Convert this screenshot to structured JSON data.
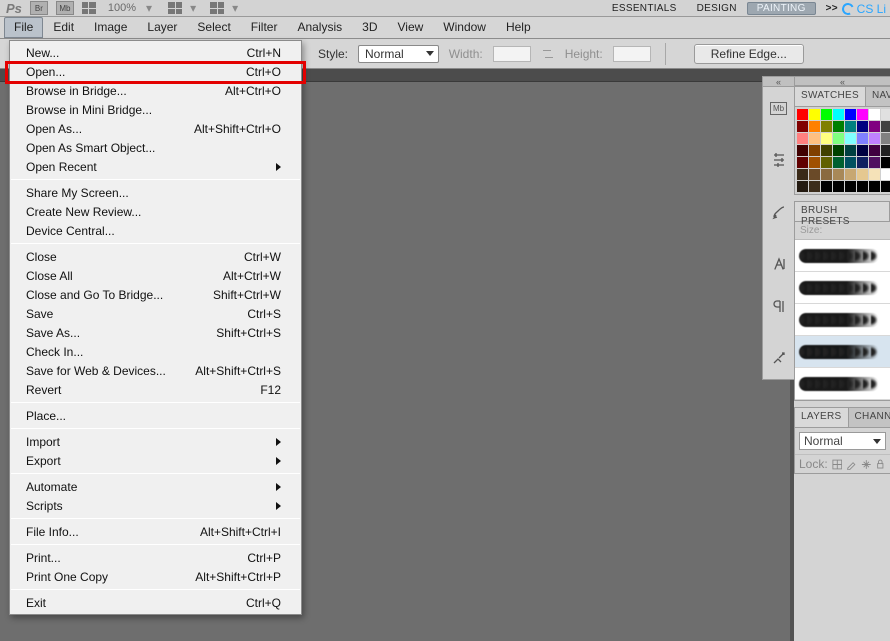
{
  "topstrip": {
    "icons": [
      "Br",
      "Mb"
    ],
    "zoom": "100%",
    "workspaces": [
      "ESSENTIALS",
      "DESIGN",
      "PAINTING"
    ],
    "active_workspace": 2,
    "more": ">>",
    "cs_label": "CS Li"
  },
  "menubar": [
    "File",
    "Edit",
    "Image",
    "Layer",
    "Select",
    "Filter",
    "Analysis",
    "3D",
    "View",
    "Window",
    "Help"
  ],
  "menubar_active": 0,
  "optionsbar": {
    "style_label": "Style:",
    "style_value": "Normal",
    "width_label": "Width:",
    "height_label": "Height:",
    "refine_label": "Refine Edge..."
  },
  "file_menu": [
    {
      "label": "New...",
      "shortcut": "Ctrl+N"
    },
    {
      "label": "Open...",
      "shortcut": "Ctrl+O",
      "highlight": true
    },
    {
      "label": "Browse in Bridge...",
      "shortcut": "Alt+Ctrl+O"
    },
    {
      "label": "Browse in Mini Bridge..."
    },
    {
      "label": "Open As...",
      "shortcut": "Alt+Shift+Ctrl+O"
    },
    {
      "label": "Open As Smart Object..."
    },
    {
      "label": "Open Recent",
      "submenu": true
    },
    {
      "sep": true
    },
    {
      "label": "Share My Screen..."
    },
    {
      "label": "Create New Review..."
    },
    {
      "label": "Device Central..."
    },
    {
      "sep": true
    },
    {
      "label": "Close",
      "shortcut": "Ctrl+W"
    },
    {
      "label": "Close All",
      "shortcut": "Alt+Ctrl+W"
    },
    {
      "label": "Close and Go To Bridge...",
      "shortcut": "Shift+Ctrl+W"
    },
    {
      "label": "Save",
      "shortcut": "Ctrl+S"
    },
    {
      "label": "Save As...",
      "shortcut": "Shift+Ctrl+S"
    },
    {
      "label": "Check In..."
    },
    {
      "label": "Save for Web & Devices...",
      "shortcut": "Alt+Shift+Ctrl+S"
    },
    {
      "label": "Revert",
      "shortcut": "F12"
    },
    {
      "sep": true
    },
    {
      "label": "Place..."
    },
    {
      "sep": true
    },
    {
      "label": "Import",
      "submenu": true
    },
    {
      "label": "Export",
      "submenu": true
    },
    {
      "sep": true
    },
    {
      "label": "Automate",
      "submenu": true
    },
    {
      "label": "Scripts",
      "submenu": true
    },
    {
      "sep": true
    },
    {
      "label": "File Info...",
      "shortcut": "Alt+Shift+Ctrl+I"
    },
    {
      "sep": true
    },
    {
      "label": "Print...",
      "shortcut": "Ctrl+P"
    },
    {
      "label": "Print One Copy",
      "shortcut": "Alt+Shift+Ctrl+P"
    },
    {
      "sep": true
    },
    {
      "label": "Exit",
      "shortcut": "Ctrl+Q"
    }
  ],
  "dock_icons": [
    "mb",
    "sliders",
    "brush",
    "character",
    "paragraph",
    "tools"
  ],
  "panels": {
    "swatches": {
      "tabs": [
        "SWATCHES",
        "NAV"
      ],
      "active_tab": 0,
      "colors": [
        "#ff0000",
        "#ffff00",
        "#00ff00",
        "#00ffff",
        "#0000ff",
        "#ff00ff",
        "#ffffff",
        "#e0e0e0",
        "#800000",
        "#ff8000",
        "#808000",
        "#008000",
        "#008080",
        "#000080",
        "#800080",
        "#404040",
        "#ff8080",
        "#ffc080",
        "#ffff80",
        "#80ff80",
        "#80ffff",
        "#8080ff",
        "#c080ff",
        "#808080",
        "#400000",
        "#804000",
        "#404000",
        "#004000",
        "#004040",
        "#000040",
        "#400040",
        "#202020",
        "#600000",
        "#a05000",
        "#606000",
        "#006030",
        "#005060",
        "#102060",
        "#501060",
        "#000000",
        "#3a2a18",
        "#6a4a28",
        "#8a6a40",
        "#a88858",
        "#c7a772",
        "#e5c890",
        "#f5e2b8",
        "#ffffff",
        "#231a10",
        "#3c2d1b",
        "#000000",
        "#000000",
        "#000000",
        "#000000",
        "#000000",
        "#000000"
      ]
    },
    "brush_presets": {
      "tabs": [
        "BRUSH PRESETS"
      ],
      "size_label": "Size:",
      "brushes": [
        {
          "sel": false
        },
        {
          "sel": false
        },
        {
          "sel": false
        },
        {
          "sel": true
        },
        {
          "sel": false
        }
      ]
    },
    "layers": {
      "tabs": [
        "LAYERS",
        "CHANN"
      ],
      "active_tab": 0,
      "blend_mode": "Normal",
      "lock_label": "Lock:"
    }
  }
}
